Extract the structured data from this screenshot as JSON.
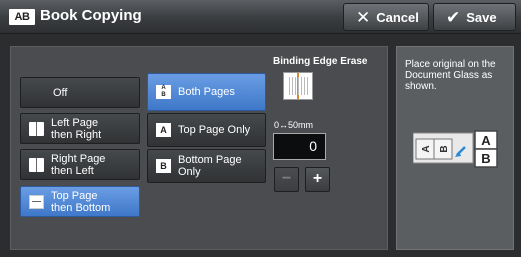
{
  "header": {
    "icon_text": "AB",
    "title": "Book Copying",
    "cancel_label": "Cancel",
    "save_label": "Save"
  },
  "options_col1": [
    {
      "label": "Off",
      "selected": false,
      "icon": "none"
    },
    {
      "label": "Left Page\nthen Right",
      "selected": false,
      "icon": "open-book-icon"
    },
    {
      "label": "Right Page\nthen Left",
      "selected": false,
      "icon": "open-book-icon"
    },
    {
      "label": "Top Page\nthen Bottom",
      "selected": true,
      "icon": "page-icon"
    }
  ],
  "options_col2": [
    {
      "label": "Both Pages",
      "selected": true,
      "icon": "ab-pages-icon"
    },
    {
      "label": "Top Page Only",
      "selected": false,
      "icon": "a-page-icon"
    },
    {
      "label": "Bottom Page\nOnly",
      "selected": false,
      "icon": "b-page-icon"
    }
  ],
  "binding_edge": {
    "label": "Binding Edge Erase",
    "range_label": "0↔50mm",
    "value": "0",
    "minus_label": "−",
    "plus_label": "+"
  },
  "info": {
    "text": "Place original on the Document Glass as shown.",
    "graphic_letters": [
      "A",
      "B"
    ]
  },
  "colors": {
    "selected": "#4f86d8",
    "background": "#2b2d2f"
  }
}
